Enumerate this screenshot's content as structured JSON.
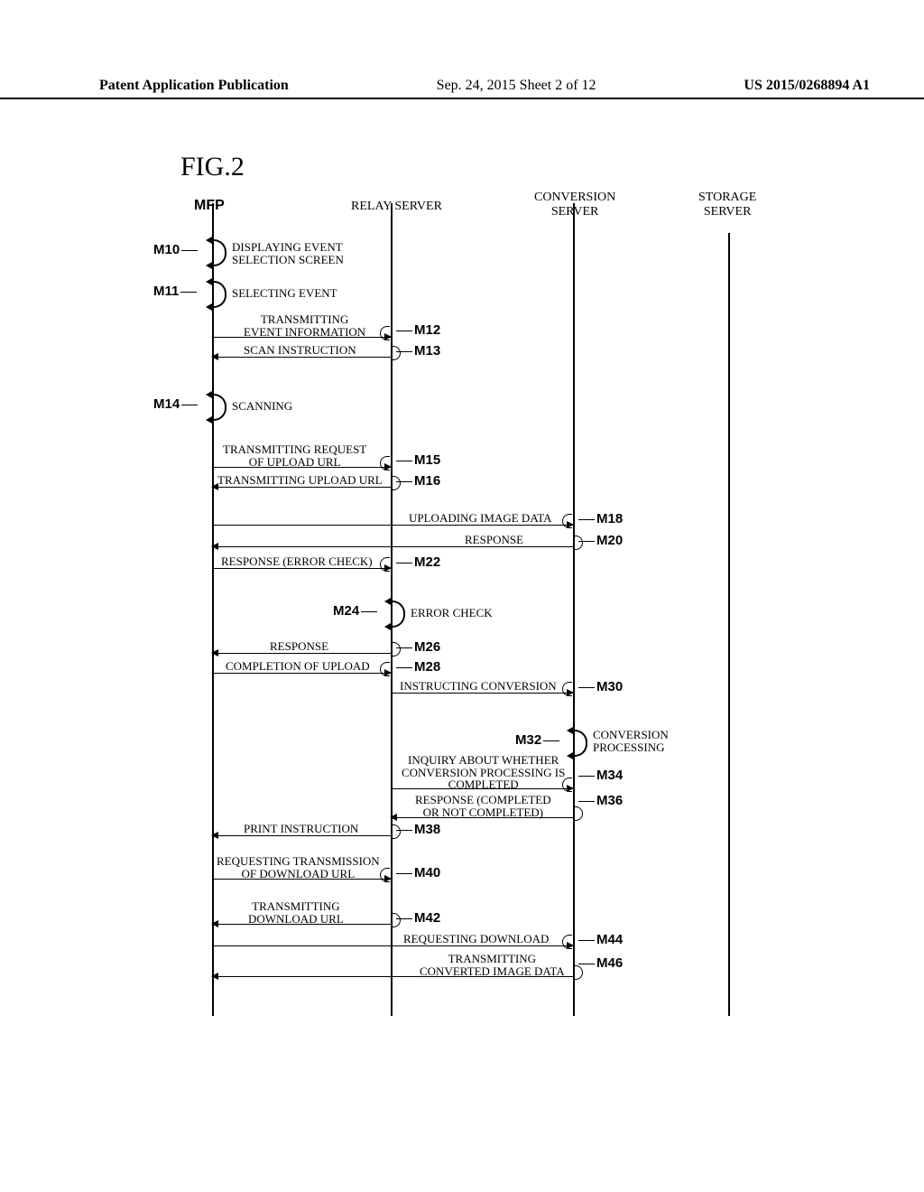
{
  "header": {
    "left": "Patent Application Publication",
    "mid": "Sep. 24, 2015   Sheet 2 of 12",
    "right": "US 2015/0268894 A1"
  },
  "figure_label": "FIG.2",
  "participants": {
    "mfp": "MFP",
    "relay": "RELAY SERVER",
    "conversion": "CONVERSION\nSERVER",
    "storage": "STORAGE\nSERVER"
  },
  "steps": {
    "m10": {
      "id": "M10",
      "text": "DISPLAYING EVENT\nSELECTION SCREEN"
    },
    "m11": {
      "id": "M11",
      "text": "SELECTING EVENT"
    },
    "m12": {
      "id": "M12",
      "text": "TRANSMITTING\nEVENT INFORMATION"
    },
    "m13": {
      "id": "M13",
      "text": "SCAN INSTRUCTION"
    },
    "m14": {
      "id": "M14",
      "text": "SCANNING"
    },
    "m15": {
      "id": "M15",
      "text": "TRANSMITTING REQUEST\nOF UPLOAD URL"
    },
    "m16": {
      "id": "M16",
      "text": "TRANSMITTING UPLOAD URL"
    },
    "m18": {
      "id": "M18",
      "text": "UPLOADING IMAGE DATA"
    },
    "m20": {
      "id": "M20",
      "text": "RESPONSE"
    },
    "m22": {
      "id": "M22",
      "text": "RESPONSE (ERROR CHECK)"
    },
    "m24": {
      "id": "M24",
      "text": "ERROR CHECK"
    },
    "m26": {
      "id": "M26",
      "text": "RESPONSE"
    },
    "m28": {
      "id": "M28",
      "text": "COMPLETION OF UPLOAD"
    },
    "m30": {
      "id": "M30",
      "text": "INSTRUCTING CONVERSION"
    },
    "m32": {
      "id": "M32",
      "text": "CONVERSION\nPROCESSING"
    },
    "m34": {
      "id": "M34",
      "text": "INQUIRY ABOUT WHETHER\nCONVERSION PROCESSING IS\nCOMPLETED"
    },
    "m36": {
      "id": "M36",
      "text": "RESPONSE (COMPLETED\nOR NOT COMPLETED)"
    },
    "m38": {
      "id": "M38",
      "text": "PRINT INSTRUCTION"
    },
    "m40": {
      "id": "M40",
      "text": "REQUESTING TRANSMISSION\nOF DOWNLOAD URL"
    },
    "m42": {
      "id": "M42",
      "text": "TRANSMITTING\nDOWNLOAD URL"
    },
    "m44": {
      "id": "M44",
      "text": "REQUESTING DOWNLOAD"
    },
    "m46": {
      "id": "M46",
      "text": "TRANSMITTING\nCONVERTED IMAGE DATA"
    }
  }
}
